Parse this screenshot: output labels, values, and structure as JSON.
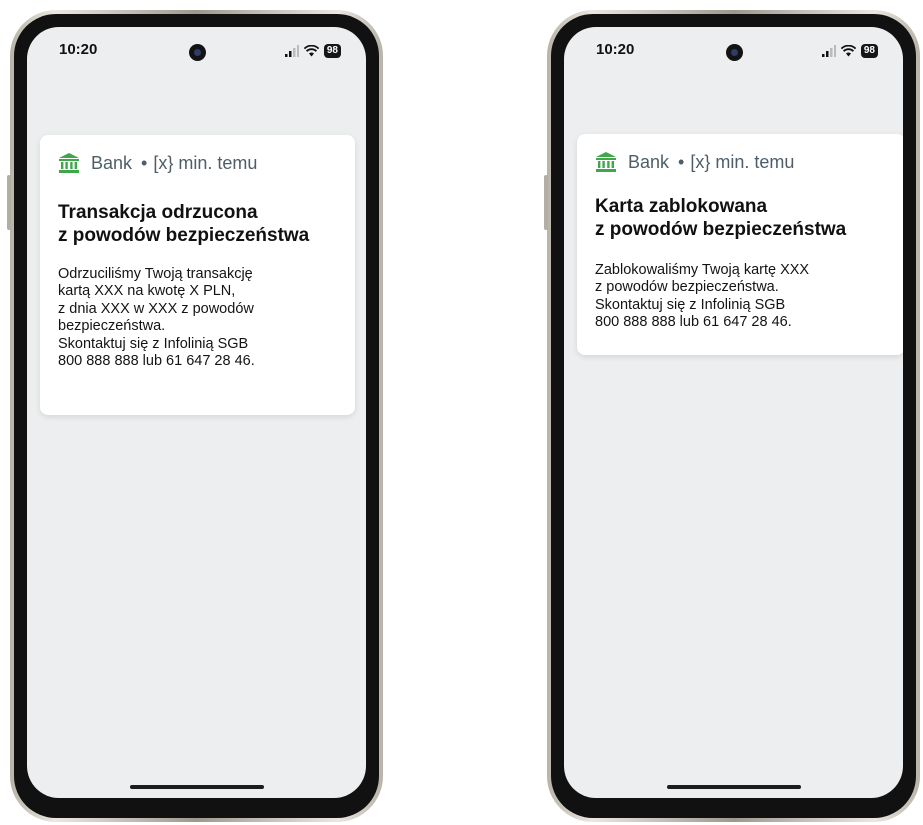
{
  "colors": {
    "accent_green": "#3fa64b",
    "header_text": "#4e5e68",
    "screen_background": "#eceeef",
    "card_background": "#ffffff"
  },
  "phones": [
    {
      "status_bar": {
        "time": "10:20",
        "battery": "98",
        "icons": [
          "signal-icon",
          "wifi-icon",
          "battery-icon"
        ]
      },
      "notification": {
        "icon": "bank-icon",
        "app_name": "Bank",
        "separator": "•",
        "time_ago": "[x} min. temu",
        "title": "Transakcja odrzucona\nz powodów bezpieczeństwa",
        "body": "Odrzuciliśmy Twoją transakcję\nkartą XXX na kwotę X PLN,\nz dnia XXX w XXX z powodów\nbezpieczeństwa.\nSkontaktuj się z Infolinią SGB\n800 888 888 lub 61 647 28 46."
      }
    },
    {
      "status_bar": {
        "time": "10:20",
        "battery": "98",
        "icons": [
          "signal-icon",
          "wifi-icon",
          "battery-icon"
        ]
      },
      "notification": {
        "icon": "bank-icon",
        "app_name": "Bank",
        "separator": "•",
        "time_ago": "[x} min. temu",
        "title": "Karta zablokowana\nz powodów bezpieczeństwa",
        "body": "Zablokowaliśmy Twoją kartę XXX\nz powodów bezpieczeństwa.\nSkontaktuj się z Infolinią SGB\n800 888 888 lub 61 647 28 46."
      }
    }
  ]
}
